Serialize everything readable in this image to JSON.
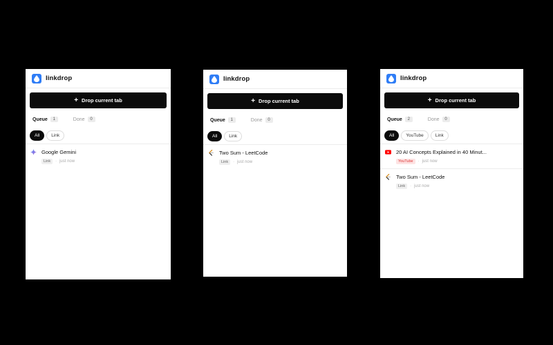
{
  "brand": {
    "name": "linkdrop",
    "accent": "#2f7df6"
  },
  "drop_button_label": "Drop current tab",
  "panels": [
    {
      "tabs": {
        "queue_label": "Queue",
        "queue_count": "1",
        "done_label": "Done",
        "done_count": "0"
      },
      "filters": [
        "All",
        "Link"
      ],
      "items": [
        {
          "title": "Google Gemini",
          "badge": "Link",
          "time": "just now",
          "icon": "gemini-icon"
        }
      ]
    },
    {
      "tabs": {
        "queue_label": "Queue",
        "queue_count": "1",
        "done_label": "Done",
        "done_count": "0"
      },
      "filters": [
        "All",
        "Link"
      ],
      "items": [
        {
          "title": "Two Sum - LeetCode",
          "badge": "Link",
          "time": "just now",
          "icon": "leetcode-icon"
        }
      ]
    },
    {
      "tabs": {
        "queue_label": "Queue",
        "queue_count": "2",
        "done_label": "Done",
        "done_count": "0"
      },
      "filters": [
        "All",
        "YouTube",
        "Link"
      ],
      "items": [
        {
          "title": "20 AI Concepts Explained in 40 Minut...",
          "badge": "YouTube",
          "time": "just now",
          "icon": "youtube-icon"
        },
        {
          "title": "Two Sum - LeetCode",
          "badge": "Link",
          "time": "just now",
          "icon": "leetcode-icon"
        }
      ]
    }
  ]
}
